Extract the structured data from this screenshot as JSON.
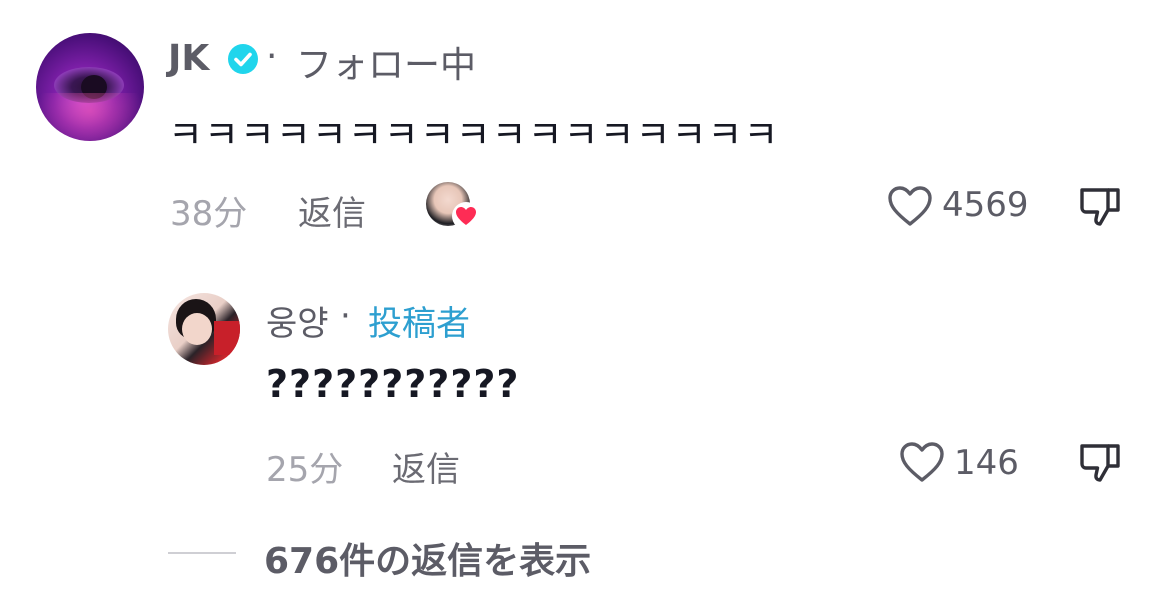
{
  "comment": {
    "username": "JK",
    "separator": "·",
    "follow_status": "フォロー中",
    "text": "ㅋㅋㅋㅋㅋㅋㅋㅋㅋㅋㅋㅋㅋㅋㅋㅋㅋ",
    "time": "38分",
    "reply_label": "返信",
    "like_count": "4569"
  },
  "reply": {
    "username": "웅양",
    "separator": "·",
    "author_tag": "投稿者",
    "text": "???????????",
    "time": "25分",
    "reply_label": "返信",
    "like_count": "146"
  },
  "view_replies": "676件の返信を表示",
  "colors": {
    "verified_badge": "#20d5ec",
    "author_tag": "#2d9fd0",
    "heart_badge": "#fe2c55",
    "text_primary": "#161823",
    "text_secondary": "#5c5c66",
    "text_muted": "#a5a5ad"
  },
  "icons": {
    "verified": "verified-check-icon",
    "like": "heart-outline-icon",
    "dislike": "thumbs-down-icon",
    "creator_liked": "heart-filled-icon"
  }
}
